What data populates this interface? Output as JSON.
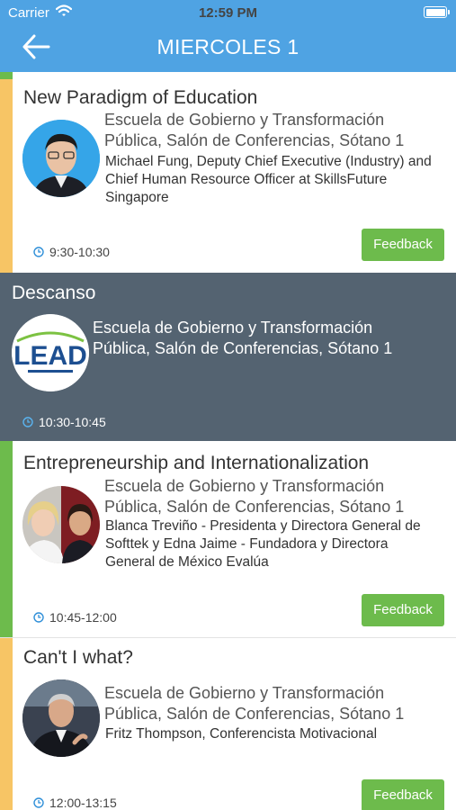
{
  "status": {
    "carrier": "Carrier",
    "time": "12:59 PM"
  },
  "nav": {
    "title": "MIERCOLES 1"
  },
  "colors": {
    "header": "#4fa3e3",
    "break_bg": "#546371",
    "accent_yellow": "#f7c565",
    "accent_green": "#6dbb4c",
    "feedback": "#6dbb4c"
  },
  "sessions": [
    {
      "title": "New Paradigm of Education",
      "location_1": "Escuela de Gobierno y Transformación",
      "location_2": "Pública, Salón de Conferencias, Sótano 1",
      "speaker_1": "Michael Fung, Deputy Chief Executive (Industry) and",
      "speaker_2": "Chief Human Resource Officer at SkillsFuture",
      "speaker_3": "Singapore",
      "time": "9:30-10:30",
      "feedback": "Feedback"
    },
    {
      "title": "Descanso",
      "logo_text": "LEAD",
      "location_1": "Escuela de Gobierno y Transformación",
      "location_2": "Pública, Salón de Conferencias, Sótano 1",
      "time": "10:30-10:45"
    },
    {
      "title": "Entrepreneurship and Internationalization",
      "location_1": "Escuela de Gobierno y Transformación",
      "location_2": "Pública, Salón de Conferencias, Sótano 1",
      "speaker_1": "Blanca Treviño - Presidenta y Directora General de",
      "speaker_2": "Softtek y Edna Jaime - Fundadora y Directora",
      "speaker_3": "General de México Evalúa",
      "time": "10:45-12:00",
      "feedback": "Feedback"
    },
    {
      "title": "Can't I what?",
      "location_1": "Escuela de Gobierno y Transformación",
      "location_2": "Pública, Salón de Conferencias, Sótano 1",
      "speaker_1": "Fritz Thompson, Conferencista Motivacional",
      "time": "12:00-13:15",
      "feedback": "Feedback"
    }
  ]
}
